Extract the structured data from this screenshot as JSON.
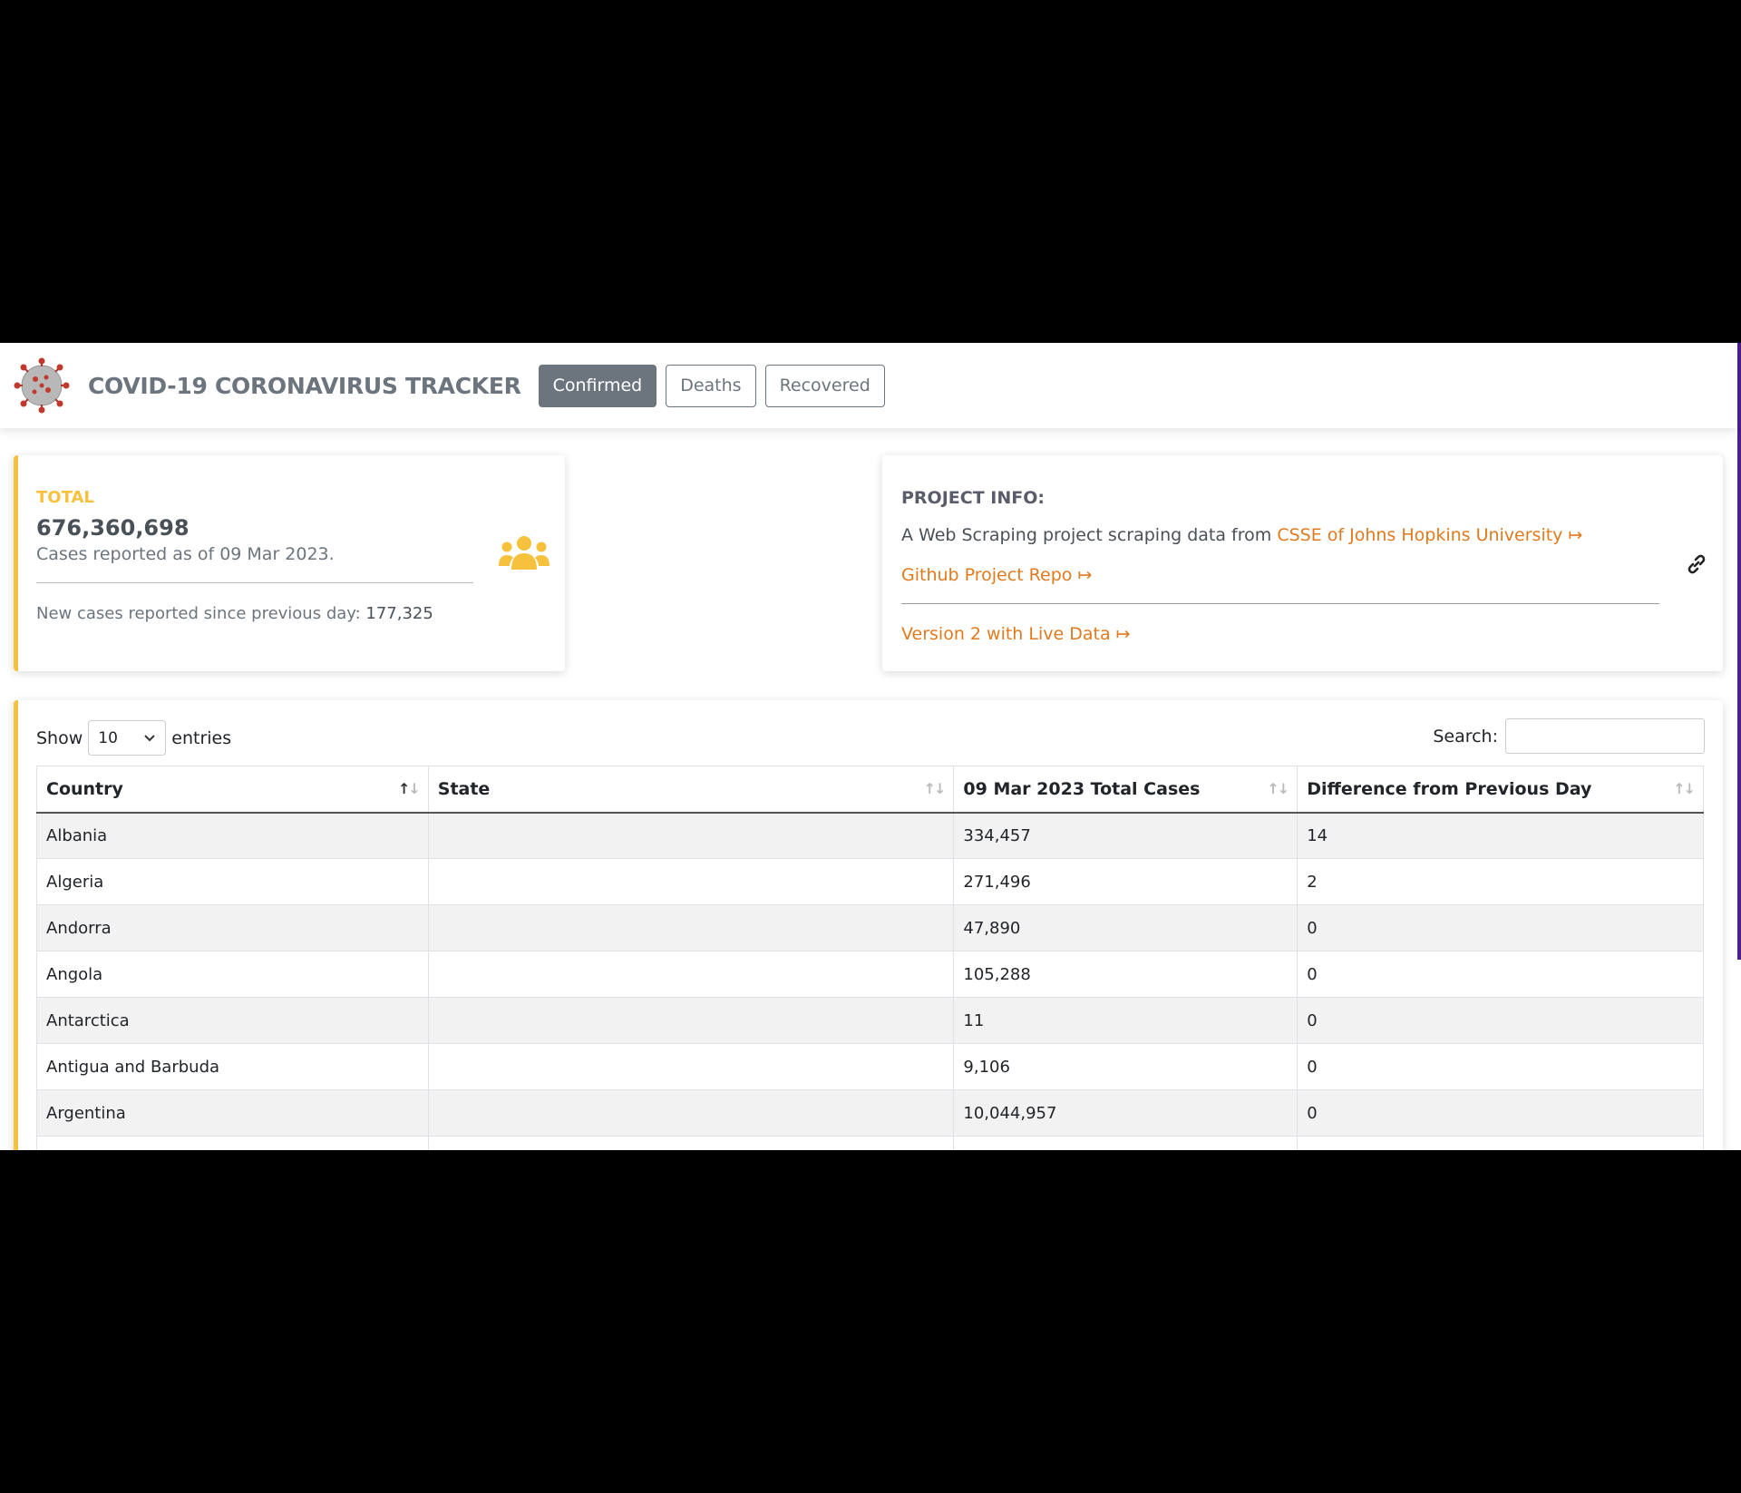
{
  "navbar": {
    "brand": "COVID-19 CORONAVIRUS TRACKER",
    "buttons": [
      {
        "label": "Confirmed",
        "active": true
      },
      {
        "label": "Deaths",
        "active": false
      },
      {
        "label": "Recovered",
        "active": false
      }
    ]
  },
  "total_card": {
    "label": "TOTAL",
    "value": "676,360,698",
    "subtitle": "Cases reported as of 09 Mar 2023.",
    "new_cases_label": "New cases reported since previous day: ",
    "new_cases_value": "177,325",
    "icon": "users-icon"
  },
  "info_card": {
    "title": "PROJECT INFO:",
    "line1_text": "A Web Scraping project scraping data from ",
    "line1_link": "CSSE of Johns Hopkins University ↦",
    "github_link": "Github Project Repo ↦",
    "v2_link": "Version 2 with Live Data ↦",
    "icon": "link-icon"
  },
  "table_controls": {
    "show_label": "Show",
    "entries_value": "10",
    "entries_label": "entries",
    "search_label": "Search:",
    "search_value": ""
  },
  "table": {
    "headers": [
      "Country",
      "State",
      "09 Mar 2023 Total Cases",
      "Difference from Previous Day"
    ],
    "rows": [
      [
        "Albania",
        "",
        "334,457",
        "14"
      ],
      [
        "Algeria",
        "",
        "271,496",
        "2"
      ],
      [
        "Andorra",
        "",
        "47,890",
        "0"
      ],
      [
        "Angola",
        "",
        "105,288",
        "0"
      ],
      [
        "Antarctica",
        "",
        "11",
        "0"
      ],
      [
        "Antigua and Barbuda",
        "",
        "9,106",
        "0"
      ],
      [
        "Argentina",
        "",
        "10,044,957",
        "0"
      ],
      [
        "",
        "",
        "",
        ""
      ]
    ]
  },
  "colors": {
    "accent_yellow": "#f6c23e",
    "link_orange": "#e07a1f",
    "secondary_gray": "#6c757d"
  }
}
